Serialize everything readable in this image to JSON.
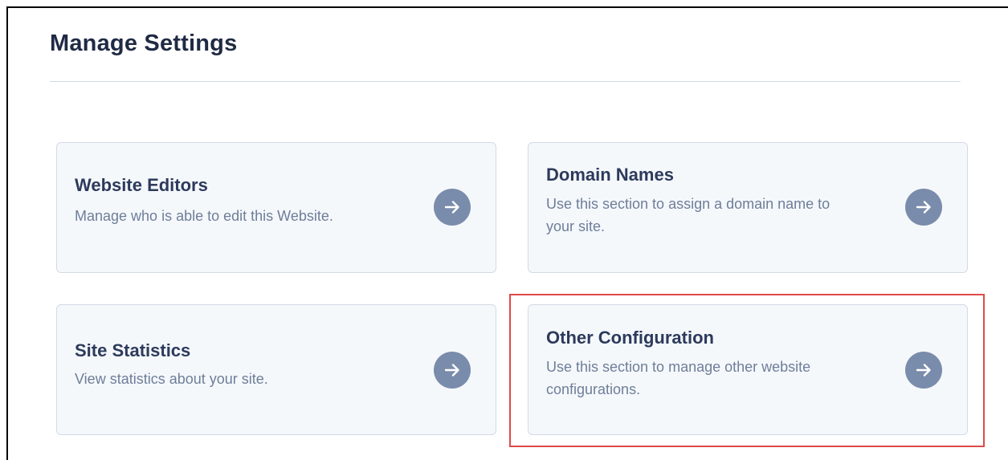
{
  "page": {
    "title": "Manage Settings"
  },
  "cards": [
    {
      "title": "Website Editors",
      "description": "Manage who is able to edit this Website.",
      "icon": "arrow-right-icon"
    },
    {
      "title": "Domain Names",
      "description": "Use this section to assign a domain name to your site.",
      "icon": "arrow-right-icon"
    },
    {
      "title": "Site Statistics",
      "description": "View statistics about your site.",
      "icon": "arrow-right-icon"
    },
    {
      "title": "Other Configuration",
      "description": "Use this section to manage other website configurations.",
      "icon": "arrow-right-icon",
      "highlighted": true
    }
  ],
  "colors": {
    "title_text": "#1f2a44",
    "card_background": "#f5f8fb",
    "card_border": "#d2dae5",
    "card_title": "#2c3a5c",
    "card_description": "#6e7e99",
    "arrow_button": "#7a8cab",
    "highlight": "#df4a4a"
  }
}
